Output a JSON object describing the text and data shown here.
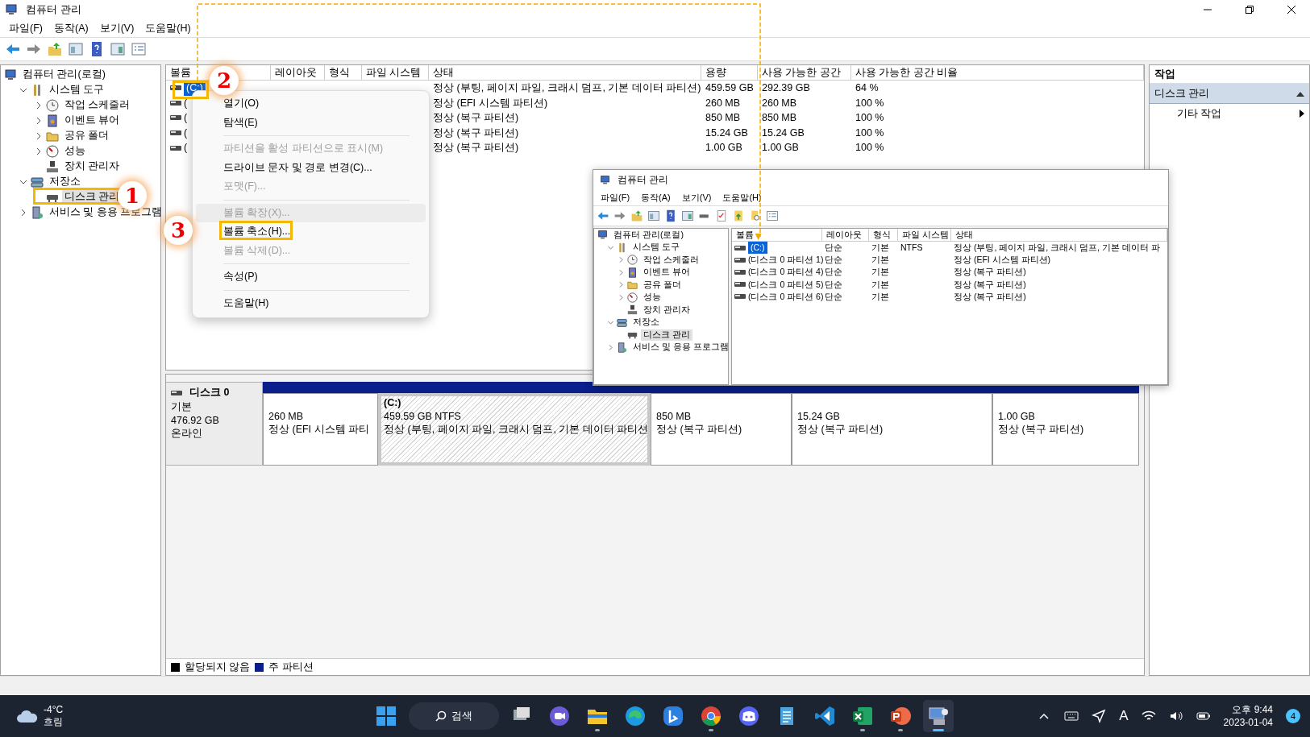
{
  "window": {
    "title": "컴퓨터 관리"
  },
  "menu": [
    "파일(F)",
    "동작(A)",
    "보기(V)",
    "도움말(H)"
  ],
  "tree": [
    {
      "label": "컴퓨터 관리(로컬)",
      "selected": false,
      "children": [
        {
          "label": "시스템 도구",
          "expanded": true,
          "selected": false,
          "children": [
            {
              "label": "작업 스케줄러",
              "expanded": false,
              "selected": false
            },
            {
              "label": "이벤트 뷰어",
              "expanded": false,
              "selected": false
            },
            {
              "label": "공유 폴더",
              "expanded": false,
              "selected": false
            },
            {
              "label": "성능",
              "expanded": false,
              "selected": false
            },
            {
              "label": "장치 관리자",
              "selected": false
            }
          ]
        },
        {
          "label": "저장소",
          "expanded": true,
          "selected": false,
          "children": [
            {
              "label": "디스크 관리",
              "selected": true
            }
          ]
        },
        {
          "label": "서비스 및 응용 프로그램",
          "expanded": false,
          "selected": false
        }
      ]
    }
  ],
  "volumes": {
    "columns": [
      "볼륨",
      "레이아웃",
      "형식",
      "파일 시스템",
      "상태",
      "용량",
      "사용 가능한 공간",
      "사용 가능한 공간 비율"
    ],
    "rows": [
      {
        "volume": "(C:)",
        "selected": true,
        "status": "정상 (부팅, 페이지 파일, 크래시 덤프, 기본 데이터 파티션)",
        "capacity": "459.59 GB",
        "free": "292.39 GB",
        "percent": "64 %"
      },
      {
        "volume": "(",
        "selected": false,
        "status": "정상 (EFI 시스템 파티션)",
        "capacity": "260 MB",
        "free": "260 MB",
        "percent": "100 %"
      },
      {
        "volume": "(",
        "selected": false,
        "status": "정상 (복구 파티션)",
        "capacity": "850 MB",
        "free": "850 MB",
        "percent": "100 %"
      },
      {
        "volume": "(",
        "selected": false,
        "status": "정상 (복구 파티션)",
        "capacity": "15.24 GB",
        "free": "15.24 GB",
        "percent": "100 %"
      },
      {
        "volume": "(",
        "selected": false,
        "status": "정상 (복구 파티션)",
        "capacity": "1.00 GB",
        "free": "1.00 GB",
        "percent": "100 %"
      }
    ]
  },
  "disk": {
    "name": "디스크 0",
    "type": "기본",
    "size": "476.92 GB",
    "state": "온라인",
    "partitions": [
      {
        "size": "260 MB",
        "status": "정상 (EFI 시스템 파티",
        "selected": false
      },
      {
        "label": "(C:)",
        "size": "459.59 GB NTFS",
        "status": "정상 (부팅, 페이지 파일, 크래시 덤프, 기본 데이터 파티션",
        "selected": true
      },
      {
        "size": "850 MB",
        "status": "정상 (복구 파티션)",
        "selected": false
      },
      {
        "size": "15.24 GB",
        "status": "정상 (복구 파티션)",
        "selected": false
      },
      {
        "size": "1.00 GB",
        "status": "정상 (복구 파티션)",
        "selected": false
      }
    ]
  },
  "legend": [
    {
      "label": "할당되지 않음",
      "color": "#000000"
    },
    {
      "label": "주 파티션",
      "color": "#0a1e8c"
    }
  ],
  "actions": {
    "title": "작업",
    "items": [
      {
        "label": "디스크 관리",
        "kind": "section",
        "selected": true
      },
      {
        "label": "기타 작업",
        "kind": "submenu",
        "selected": false
      }
    ]
  },
  "context_menu": [
    {
      "kind": "item",
      "label": "열기(O)",
      "disabled": false,
      "selected": false
    },
    {
      "kind": "item",
      "label": "탐색(E)",
      "disabled": false,
      "selected": false
    },
    {
      "kind": "separator"
    },
    {
      "kind": "item",
      "label": "파티션을 활성 파티션으로 표시(M)",
      "disabled": true,
      "selected": false
    },
    {
      "kind": "item",
      "label": "드라이브 문자 및 경로 변경(C)...",
      "disabled": false,
      "selected": false
    },
    {
      "kind": "item",
      "label": "포맷(F)...",
      "disabled": true,
      "selected": false
    },
    {
      "kind": "separator"
    },
    {
      "kind": "item",
      "label": "볼륨 확장(X)...",
      "disabled": true,
      "selected": true
    },
    {
      "kind": "item",
      "label": "볼륨 축소(H)...",
      "disabled": false,
      "selected": false
    },
    {
      "kind": "item",
      "label": "볼륨 삭제(D)...",
      "disabled": true,
      "selected": false
    },
    {
      "kind": "separator"
    },
    {
      "kind": "item",
      "label": "속성(P)",
      "disabled": false,
      "selected": false
    },
    {
      "kind": "separator"
    },
    {
      "kind": "item",
      "label": "도움말(H)",
      "disabled": false,
      "selected": false
    }
  ],
  "inset": {
    "title": "컴퓨터 관리",
    "menu": [
      "파일(F)",
      "동작(A)",
      "보기(V)",
      "도움말(H)"
    ],
    "tree": [
      {
        "label": "컴퓨터 관리(로컬)",
        "selected": false,
        "children": [
          {
            "label": "시스템 도구",
            "expanded": true,
            "selected": false,
            "children": [
              {
                "label": "작업 스케줄러",
                "expanded": false,
                "selected": false
              },
              {
                "label": "이벤트 뷰어",
                "expanded": false,
                "selected": false
              },
              {
                "label": "공유 폴더",
                "expanded": false,
                "selected": false
              },
              {
                "label": "성능",
                "expanded": false,
                "selected": false
              },
              {
                "label": "장치 관리자",
                "selected": false
              }
            ]
          },
          {
            "label": "저장소",
            "expanded": true,
            "selected": false,
            "children": [
              {
                "label": "디스크 관리",
                "selected": true
              }
            ]
          },
          {
            "label": "서비스 및 응용 프로그램",
            "expanded": false,
            "selected": false
          }
        ]
      }
    ],
    "columns": [
      "볼륨",
      "레이아웃",
      "형식",
      "파일 시스템",
      "상태"
    ],
    "rows": [
      {
        "volume": "(C:)",
        "layout": "단순",
        "type": "기본",
        "fs": "NTFS",
        "status": "정상 (부팅, 페이지 파일, 크래시 덤프, 기본 데이터 파",
        "selected": true
      },
      {
        "volume": "(디스크 0 파티션 1)",
        "layout": "단순",
        "type": "기본",
        "status": "정상 (EFI 시스템 파티션)",
        "selected": false
      },
      {
        "volume": "(디스크 0 파티션 4)",
        "layout": "단순",
        "type": "기본",
        "status": "정상 (복구 파티션)",
        "selected": false
      },
      {
        "volume": "(디스크 0 파티션 5)",
        "layout": "단순",
        "type": "기본",
        "status": "정상 (복구 파티션)",
        "selected": false
      },
      {
        "volume": "(디스크 0 파티션 6)",
        "layout": "단순",
        "type": "기본",
        "status": "정상 (복구 파티션)",
        "selected": false
      }
    ]
  },
  "callouts": [
    "1",
    "2",
    "3"
  ],
  "taskbar": {
    "weather": {
      "temp": "-4°C",
      "condition": "흐림"
    },
    "search": "검색",
    "apps": [
      {
        "kind": "taskview",
        "running": false,
        "selected": false
      },
      {
        "kind": "chat",
        "running": false,
        "selected": false
      },
      {
        "kind": "explorer",
        "running": true,
        "selected": false
      },
      {
        "kind": "edge",
        "running": false,
        "selected": false
      },
      {
        "kind": "bing",
        "running": false,
        "selected": false
      },
      {
        "kind": "chrome",
        "running": true,
        "selected": false
      },
      {
        "kind": "discord",
        "running": false,
        "selected": false
      },
      {
        "kind": "notepad",
        "running": false,
        "selected": false
      },
      {
        "kind": "vscode",
        "running": false,
        "selected": false
      },
      {
        "kind": "excel",
        "running": true,
        "selected": false
      },
      {
        "kind": "powerpoint",
        "running": true,
        "selected": false
      },
      {
        "kind": "compmgmt",
        "running": true,
        "selected": true
      }
    ],
    "ime": "A",
    "time": "오후 9:44",
    "date": "2023-01-04",
    "notifications": "4"
  }
}
